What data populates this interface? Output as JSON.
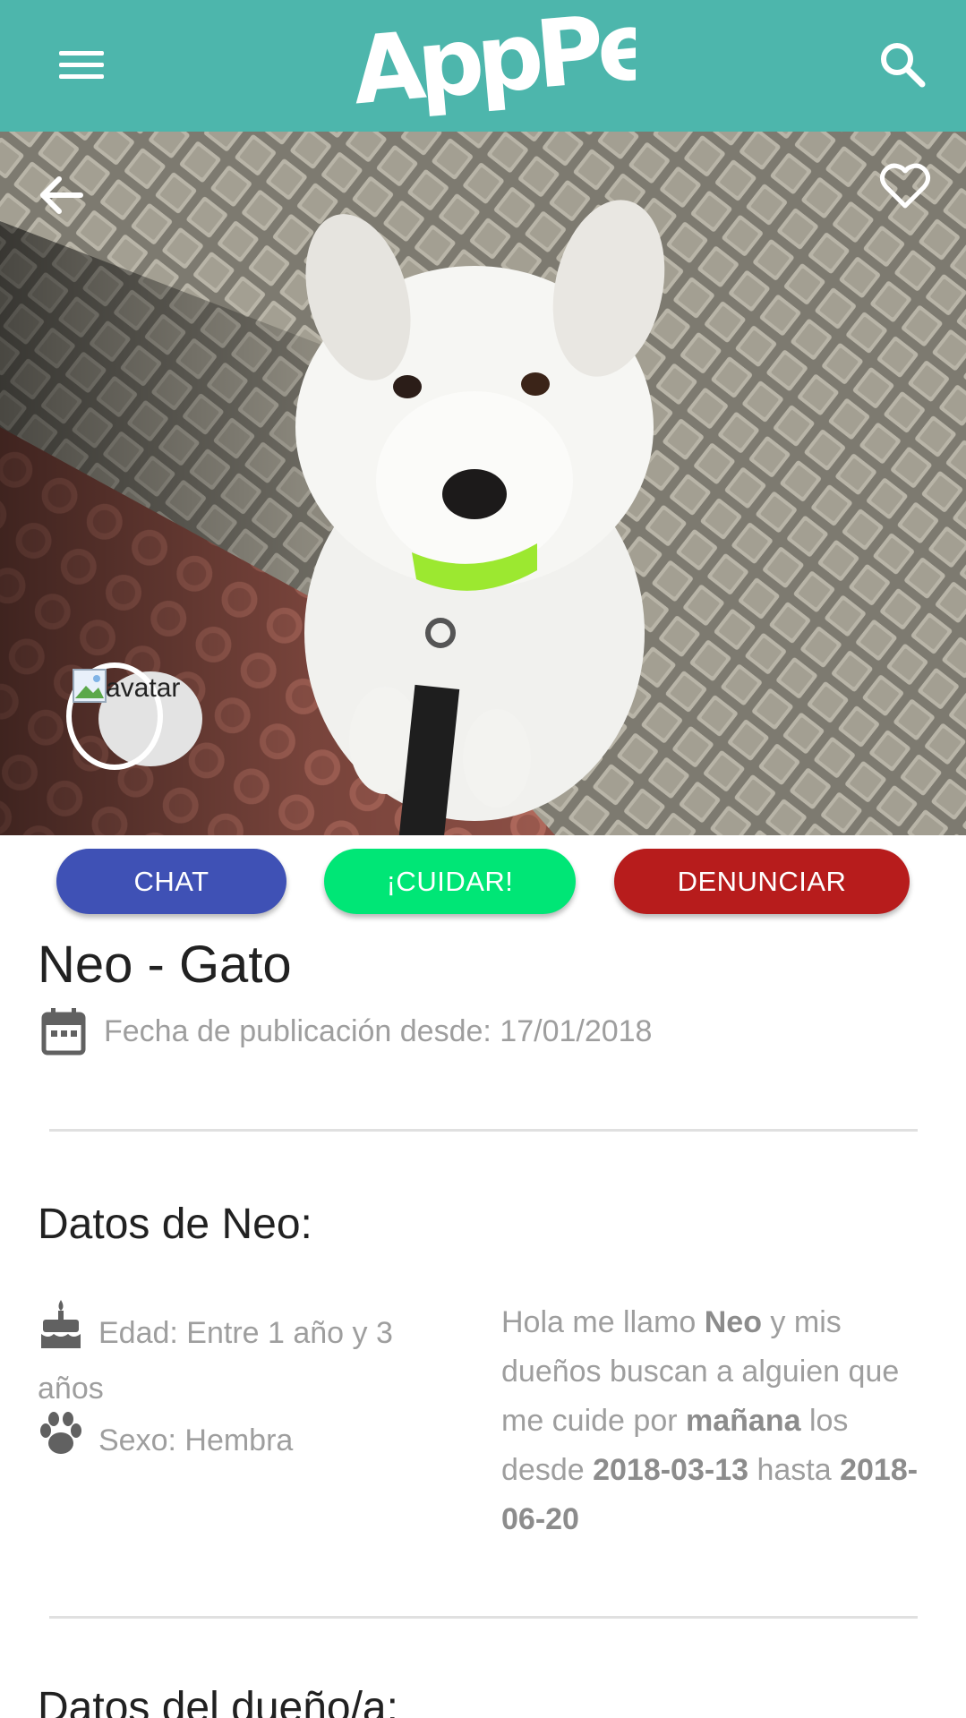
{
  "header": {
    "logo_text": "AppPet",
    "menu_icon": "hamburger-menu-icon",
    "search_icon": "search-icon",
    "bar_color": "#4db6ac"
  },
  "hero": {
    "back_icon": "arrow-back-icon",
    "favorite_icon": "heart-outline-icon",
    "avatar_alt": "avatar"
  },
  "actions": {
    "chat_label": "CHAT",
    "cuidar_label": "¡CUIDAR!",
    "denunciar_label": "DENUNCIAR",
    "chat_color": "#3f51b5",
    "cuidar_color": "#00e676",
    "denunciar_color": "#b71c1c"
  },
  "pet": {
    "title": "Neo - Gato",
    "publication_label": "Fecha de publicación desde: 17/01/2018"
  },
  "pet_data": {
    "section_title": "Datos de Neo:",
    "age": "Edad: Entre 1 año y 3 años",
    "sex": "Sexo: Hembra",
    "description": {
      "p1": "Hola me llamo ",
      "name": "Neo",
      "p2": " y mis dueños buscan a alguien que me cuide por ",
      "period": "mañana",
      "p3": " los desde ",
      "from": "2018-03-13",
      "p4": " hasta ",
      "to": "2018-06-20"
    }
  },
  "owner_data": {
    "section_title": "Datos del dueño/a:"
  }
}
